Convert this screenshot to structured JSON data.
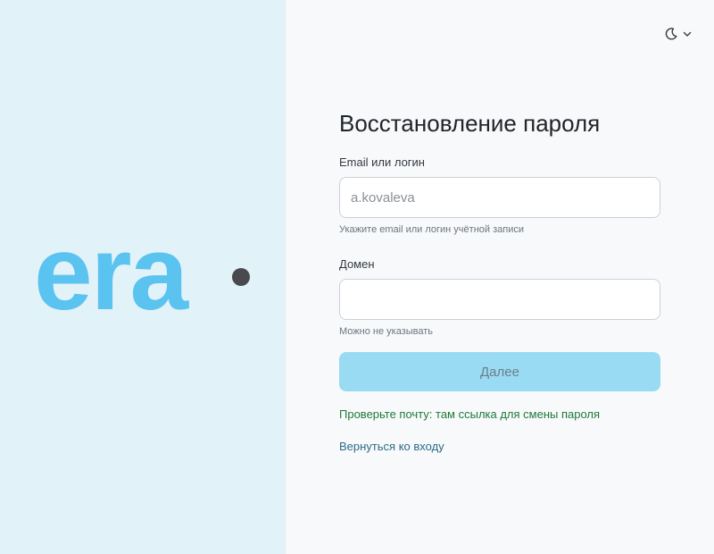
{
  "logo": {
    "text": "era",
    "brand_color": "#5bc3f0",
    "dot_color": "#4a4a4e"
  },
  "theme_toggle": {
    "icon": "moon-icon",
    "dropdown_icon": "chevron-down-icon"
  },
  "form": {
    "title": "Восстановление пароля",
    "login": {
      "label": "Email или логин",
      "value": "",
      "placeholder": "a.kovaleva",
      "hint": "Укажите email или логин учётной записи"
    },
    "domain": {
      "label": "Домен",
      "value": "",
      "placeholder": "",
      "hint": "Можно не указывать"
    },
    "submit_label": "Далее",
    "success_message": "Проверьте почту: там ссылка для смены пароля",
    "back_link": "Вернуться ко входу"
  },
  "colors": {
    "left_panel_bg": "#e1f2f9",
    "right_panel_bg": "#f8f9fb",
    "button_bg": "#99dbf3",
    "success_text": "#1e7a38",
    "link_text": "#2c6b8a"
  }
}
